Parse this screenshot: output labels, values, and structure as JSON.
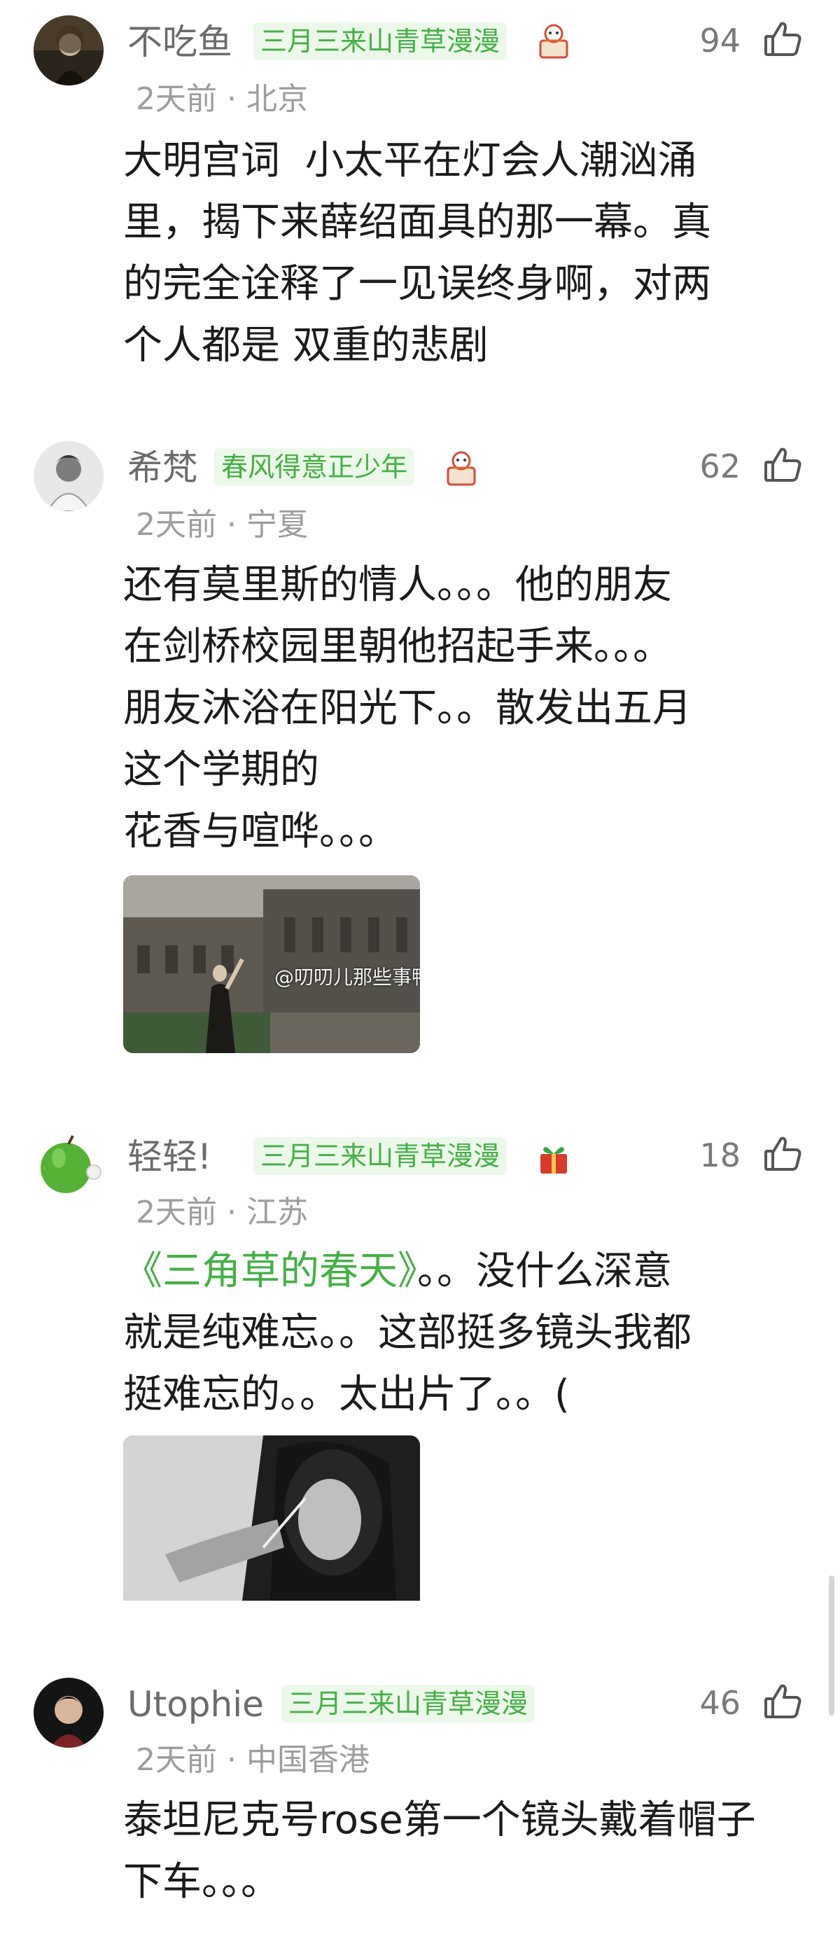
{
  "comments": [
    {
      "username": "不吃鱼",
      "badge": "三月三来山青草漫漫",
      "medal_icon": "cake-medal-icon",
      "likes": "94",
      "time": "2天前",
      "location": "北京",
      "text": "大明宫词  小太平在灯会人潮汹涌\n里，揭下来薛绍面具的那一幕。真\n的完全诠释了一见误终身啊，对两\n个人都是 双重的悲剧"
    },
    {
      "username": "希梵",
      "badge": "春风得意正少年",
      "medal_icon": "cake-medal-icon",
      "likes": "62",
      "time": "2天前",
      "location": "宁夏",
      "text": "还有莫里斯的情人。。。他的朋友\n在剑桥校园里朝他招起手来。。。\n朋友沐浴在阳光下。。散发出五月\n这个学期的\n花香与喧哗。。。",
      "image_watermark": "@叨叨儿那些事鸭"
    },
    {
      "username": "轻轻!",
      "badge": "三月三来山青草漫漫",
      "medal_icon": "gift-medal-icon",
      "likes": "18",
      "time": "2天前",
      "location": "江苏",
      "text_link": "《三角草的春天》",
      "text": "。。没什么深意\n就是纯难忘。。这部挺多镜头我都\n挺难忘的。。太出片了。。("
    },
    {
      "username": "Utophie",
      "badge": "三月三来山青草漫漫",
      "likes": "46",
      "time": "2天前",
      "location": "中国香港",
      "text": "泰坦尼克号rose第一个镜头戴着帽子\n下车。。。"
    }
  ],
  "colors": {
    "badge_text": "#45b045",
    "badge_bg": "#ecf8ea",
    "username": "#6b6b6b",
    "meta": "#9d9d9d"
  }
}
